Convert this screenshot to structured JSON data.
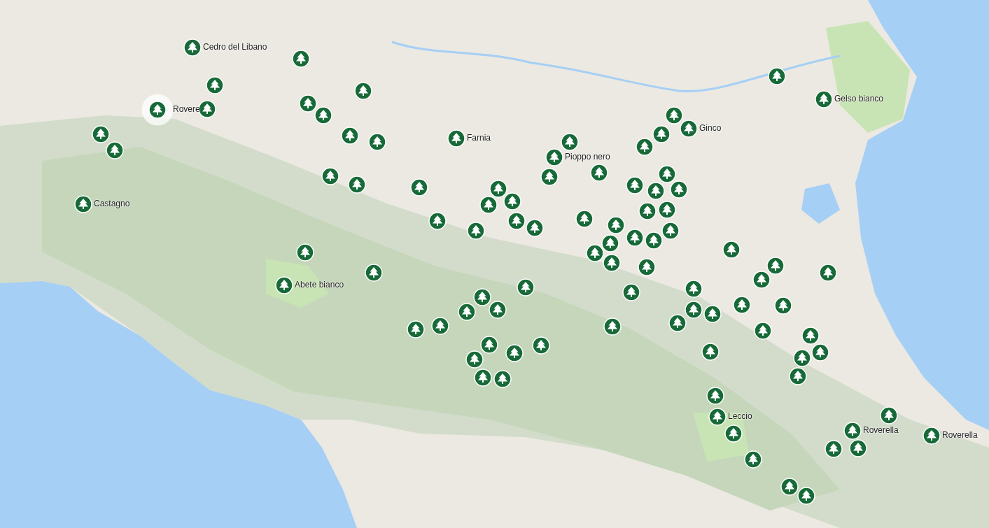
{
  "map": {
    "markers": [
      {
        "label": "Cedro del Libano",
        "selected": false
      },
      {
        "selected": false
      },
      {
        "selected": false
      },
      {
        "selected": false
      },
      {
        "selected": false
      },
      {
        "label": "Gelso bianco",
        "selected": false
      },
      {
        "selected": false
      },
      {
        "selected": false
      },
      {
        "label": "Rovere",
        "selected": true
      },
      {
        "selected": false
      },
      {
        "selected": false
      },
      {
        "label": "Ginco",
        "selected": false
      },
      {
        "selected": false
      },
      {
        "selected": false
      },
      {
        "selected": false
      },
      {
        "label": "Farnia",
        "selected": false
      },
      {
        "selected": false
      },
      {
        "selected": false
      },
      {
        "selected": false
      },
      {
        "selected": false
      },
      {
        "label": "Pioppo nero",
        "selected": false
      },
      {
        "selected": false
      },
      {
        "selected": false
      },
      {
        "selected": false
      },
      {
        "selected": false
      },
      {
        "selected": false
      },
      {
        "selected": false
      },
      {
        "selected": false
      },
      {
        "selected": false
      },
      {
        "selected": false
      },
      {
        "selected": false
      },
      {
        "selected": false
      },
      {
        "label": "Castagno",
        "selected": false
      },
      {
        "selected": false
      },
      {
        "selected": false
      },
      {
        "selected": false
      },
      {
        "selected": false
      },
      {
        "selected": false
      },
      {
        "selected": false
      },
      {
        "selected": false
      },
      {
        "selected": false
      },
      {
        "selected": false
      },
      {
        "selected": false
      },
      {
        "selected": false
      },
      {
        "selected": false
      },
      {
        "selected": false
      },
      {
        "selected": false
      },
      {
        "selected": false
      },
      {
        "selected": false
      },
      {
        "selected": false
      },
      {
        "selected": false
      },
      {
        "selected": false
      },
      {
        "selected": false
      },
      {
        "selected": false
      },
      {
        "label": "Abete bianco",
        "selected": false
      },
      {
        "selected": false
      },
      {
        "selected": false
      },
      {
        "selected": false
      },
      {
        "selected": false
      },
      {
        "selected": false
      },
      {
        "selected": false
      },
      {
        "selected": false
      },
      {
        "selected": false
      },
      {
        "selected": false
      },
      {
        "selected": false
      },
      {
        "selected": false
      },
      {
        "selected": false
      },
      {
        "selected": false
      },
      {
        "selected": false
      },
      {
        "selected": false
      },
      {
        "selected": false
      },
      {
        "selected": false
      },
      {
        "selected": false
      },
      {
        "selected": false
      },
      {
        "selected": false
      },
      {
        "selected": false
      },
      {
        "selected": false
      },
      {
        "selected": false
      },
      {
        "selected": false
      },
      {
        "selected": false
      },
      {
        "selected": false
      },
      {
        "selected": false
      },
      {
        "label": "Leccio",
        "selected": false
      },
      {
        "selected": false
      },
      {
        "selected": false
      },
      {
        "label": "Roverella",
        "selected": false
      },
      {
        "label": "Roverella",
        "selected": false
      },
      {
        "selected": false
      },
      {
        "selected": false
      },
      {
        "selected": false
      },
      {
        "selected": false
      },
      {
        "selected": false
      },
      {
        "selected": false
      }
    ]
  }
}
